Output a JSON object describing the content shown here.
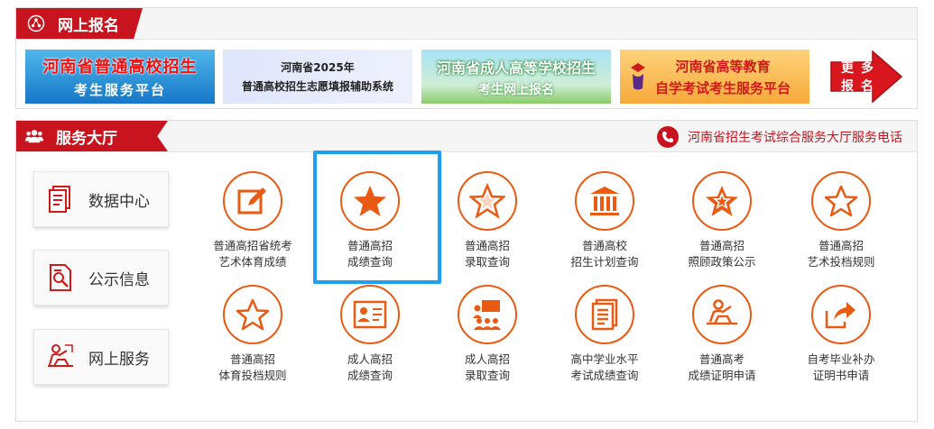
{
  "online_registration": {
    "title": "网上报名",
    "banners": [
      {
        "line1": "河南省普通高校招生",
        "line2": "考生服务平台"
      },
      {
        "line1": "河南省2025年",
        "line2": "普通高校招生志愿填报辅助系统"
      },
      {
        "line1": "河南省成人高等学校招生",
        "line2": "考生网上报名"
      },
      {
        "line1": "河南省高等教育",
        "line2": "自学考试考生服务平台"
      }
    ],
    "more": {
      "chars": [
        "更",
        "多",
        "报",
        "名"
      ]
    }
  },
  "service_hall": {
    "title": "服务大厅",
    "hotline": "河南省招生考试综合服务大厅服务电话",
    "side_buttons": [
      {
        "label": "数据中心",
        "icon": "document-stack-icon"
      },
      {
        "label": "公示信息",
        "icon": "document-search-icon"
      },
      {
        "label": "网上服务",
        "icon": "presenter-icon"
      }
    ],
    "services": [
      {
        "line1": "普通高招省统考",
        "line2": "艺术体育成绩",
        "icon": "edit-icon"
      },
      {
        "line1": "普通高招",
        "line2": "成绩查询",
        "icon": "star-solid-icon"
      },
      {
        "line1": "普通高招",
        "line2": "录取查询",
        "icon": "star-badge-icon"
      },
      {
        "line1": "普通高校",
        "line2": "招生计划查询",
        "icon": "building-icon"
      },
      {
        "line1": "普通高招",
        "line2": "照顾政策公示",
        "icon": "star-ribbon-icon"
      },
      {
        "line1": "普通高招",
        "line2": "艺术投档规则",
        "icon": "star-outline-icon"
      },
      {
        "line1": "普通高招",
        "line2": "体育投档规则",
        "icon": "star-outline-icon"
      },
      {
        "line1": "成人高招",
        "line2": "成绩查询",
        "icon": "id-card-icon"
      },
      {
        "line1": "成人高招",
        "line2": "录取查询",
        "icon": "group-presentation-icon"
      },
      {
        "line1": "高中学业水平",
        "line2": "考试成绩查询",
        "icon": "document-list-icon"
      },
      {
        "line1": "普通高考",
        "line2": "成绩证明申请",
        "icon": "person-desk-icon"
      },
      {
        "line1": "自考毕业补办",
        "line2": "证明书申请",
        "icon": "export-arrow-icon"
      }
    ]
  },
  "colors": {
    "brand_red": "#c8141e",
    "service_orange": "#e95a12",
    "selection_blue": "#1e9ff2"
  }
}
